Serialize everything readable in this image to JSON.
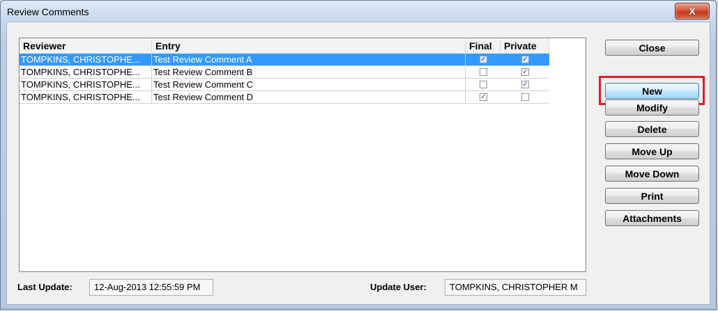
{
  "window": {
    "title": "Review Comments",
    "close_glyph": "X"
  },
  "grid": {
    "columns": [
      "Reviewer",
      "Entry",
      "Final",
      "Private"
    ],
    "rows": [
      {
        "reviewer": "TOMPKINS, CHRISTOPHE...",
        "entry": "Test Review Comment A",
        "final": true,
        "private": true,
        "selected": true
      },
      {
        "reviewer": "TOMPKINS, CHRISTOPHE...",
        "entry": "Test Review Comment B",
        "final": false,
        "private": true,
        "selected": false
      },
      {
        "reviewer": "TOMPKINS, CHRISTOPHE...",
        "entry": "Test Review Comment C",
        "final": false,
        "private": true,
        "selected": false
      },
      {
        "reviewer": "TOMPKINS, CHRISTOPHE...",
        "entry": "Test Review Comment D",
        "final": true,
        "private": false,
        "selected": false
      }
    ]
  },
  "buttons": {
    "close": "Close",
    "new": "New",
    "modify": "Modify",
    "delete": "Delete",
    "move_up": "Move Up",
    "move_down": "Move Down",
    "print": "Print",
    "attachments": "Attachments"
  },
  "footer": {
    "last_update_label": "Last Update:",
    "last_update_value": "12-Aug-2013 12:55:59 PM",
    "update_user_label": "Update User:",
    "update_user_value": "TOMPKINS, CHRISTOPHER M"
  },
  "colors": {
    "selection": "#3399ff",
    "highlight_box": "#e21d23",
    "close_button": "#c23a1e"
  },
  "icons": {
    "checkbox_checked": "✓"
  }
}
